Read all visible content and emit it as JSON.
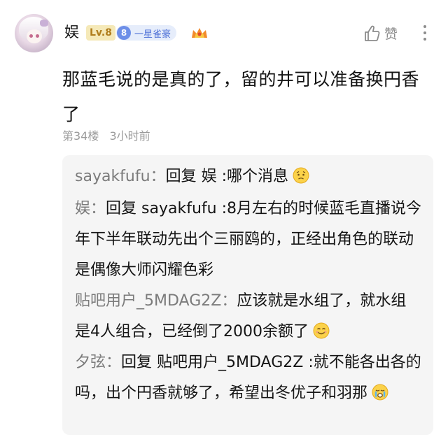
{
  "post": {
    "username": "娱",
    "level": "Lv.8",
    "fan_level": "8",
    "fan_title": "一星雀豪",
    "like_label": "赞",
    "content": "那蓝毛说的是真的了，留的井可以准备换円香了",
    "floor": "第34楼",
    "time": "3小时前"
  },
  "replies": [
    {
      "author": "sayakfufu",
      "sep": "：",
      "text": "回复 娱 :哪个消息",
      "emoji": "worried-face"
    },
    {
      "author": "娱",
      "sep": "：",
      "text": "回复 sayakfufu :8月左右的时候蓝毛直播说今年下半年联动先出个三丽鸥的，正经出角色的联动是偶像大师闪耀色彩",
      "emoji": ""
    },
    {
      "author": "贴吧用户_5MDAG2Z",
      "sep": "：",
      "text": "应该就是水组了，就水组是4人组合，已经倒了2000余额了",
      "emoji": "smile-face"
    },
    {
      "author": "夕弦",
      "sep": "：",
      "text": "回复 贴吧用户_5MDAG2Z :就不能各出各的吗，出个円香就够了，希望出冬优子和羽那",
      "emoji": "crying-face"
    }
  ],
  "colors": {
    "text": "#141414",
    "meta": "#9a9a9a",
    "reply_author": "#7b7b7b",
    "reply_bg": "#f5f5f5",
    "level_badge_bg": "#f5e9b8",
    "fan_badge_bg": "#e6edfb"
  },
  "icons": [
    "avatar",
    "crown-icon",
    "thumbs-up-icon",
    "more-vertical-icon"
  ]
}
